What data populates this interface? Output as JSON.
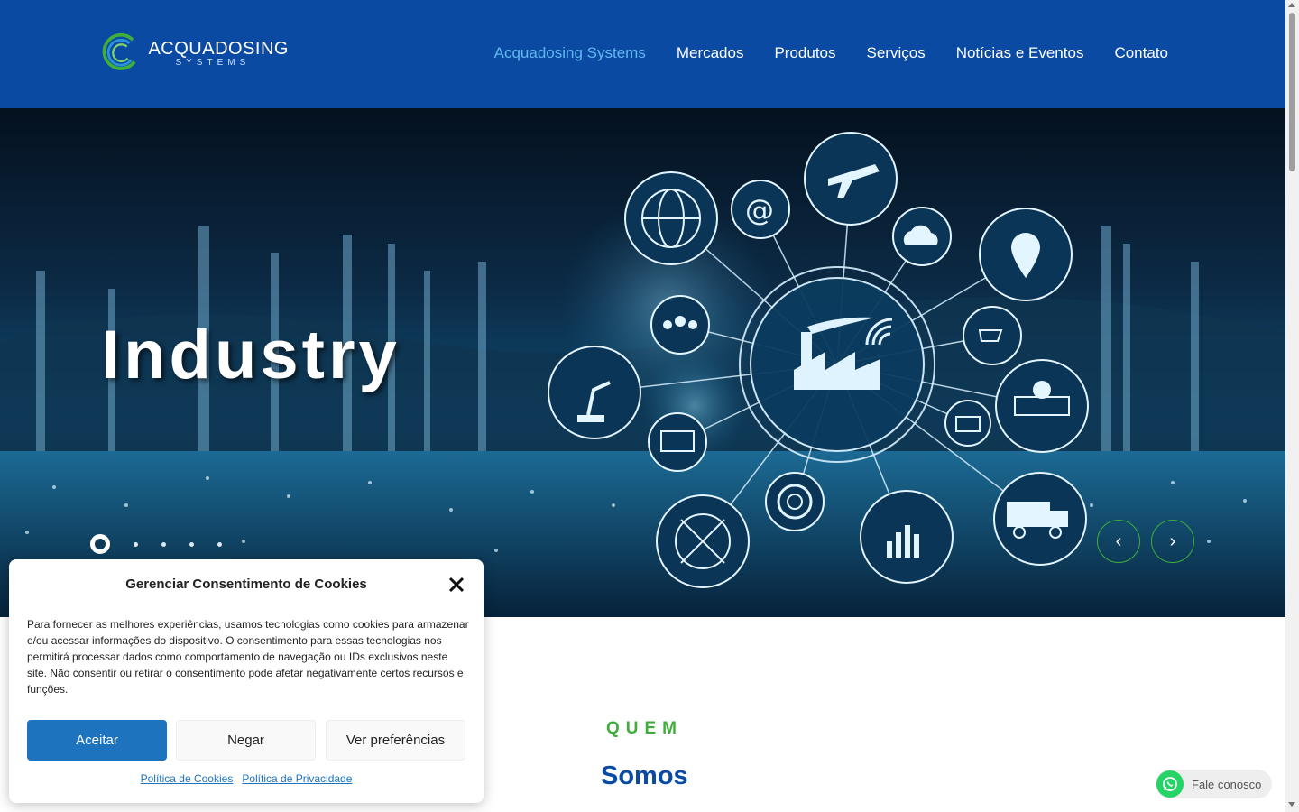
{
  "header": {
    "logo": {
      "title": "ACQUADOSING",
      "subtitle": "SYSTEMS"
    },
    "nav": [
      {
        "label": "Acquadosing Systems",
        "active": true
      },
      {
        "label": "Mercados"
      },
      {
        "label": "Produtos"
      },
      {
        "label": "Serviços"
      },
      {
        "label": "Notícias e Eventos"
      },
      {
        "label": "Contato"
      }
    ],
    "nav_active_color": "#62b8f0",
    "background_color": "#0a4aa3"
  },
  "hero": {
    "title": "Industry",
    "slides_count": 5,
    "active_slide": 1,
    "prev_icon": "chevron-left-icon",
    "next_icon": "chevron-right-icon"
  },
  "section": {
    "label": "QUEM",
    "title": "Somos"
  },
  "whatsapp": {
    "label": "Fale conosco",
    "icon": "whatsapp-icon"
  },
  "cookie": {
    "title": "Gerenciar Consentimento de Cookies",
    "body": "Para fornecer as melhores experiências, usamos tecnologias como cookies para armazenar e/ou acessar informações do dispositivo. O consentimento para essas tecnologias nos permitirá processar dados como comportamento de navegação ou IDs exclusivos neste site. Não consentir ou retirar o consentimento pode afetar negativamente certos recursos e funções.",
    "accept": "Aceitar",
    "deny": "Negar",
    "preferences": "Ver preferências",
    "cookie_policy": "Política de Cookies",
    "privacy_policy": "Política de Privacidade",
    "accent_color": "#1e73be"
  },
  "colors": {
    "brand_blue": "#0a4aa3",
    "brand_green": "#3fae3a"
  }
}
